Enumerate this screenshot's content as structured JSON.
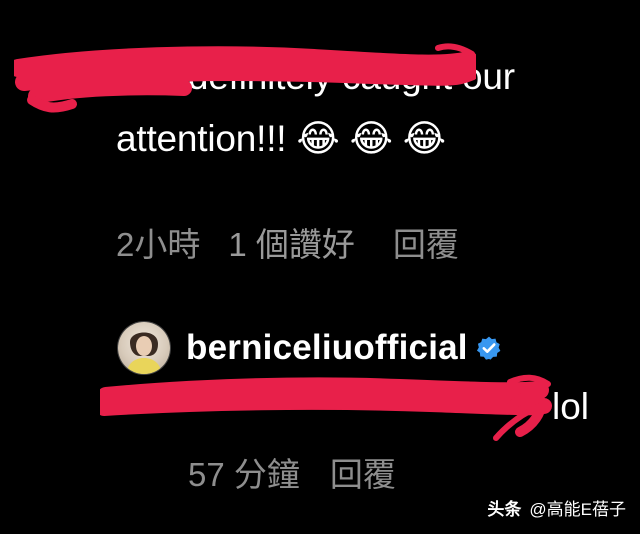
{
  "comment": {
    "text": "You definitely caught our attention!!! 😂 😂 😂",
    "time": "2小時",
    "likes": "1 個讚好",
    "reply_label": "回覆"
  },
  "reply": {
    "username": "berniceliuofficial",
    "text": "lol",
    "time": "57 分鐘",
    "reply_label": "回覆",
    "verified_icon": "verified-badge-icon"
  },
  "watermark": {
    "brand": "头条",
    "handle": "@高能E蓓子"
  },
  "colors": {
    "background": "#000000",
    "text": "#ffffff",
    "meta_text": "#8e8e8e",
    "redaction": "#e8204a",
    "verified": "#3897f0"
  }
}
